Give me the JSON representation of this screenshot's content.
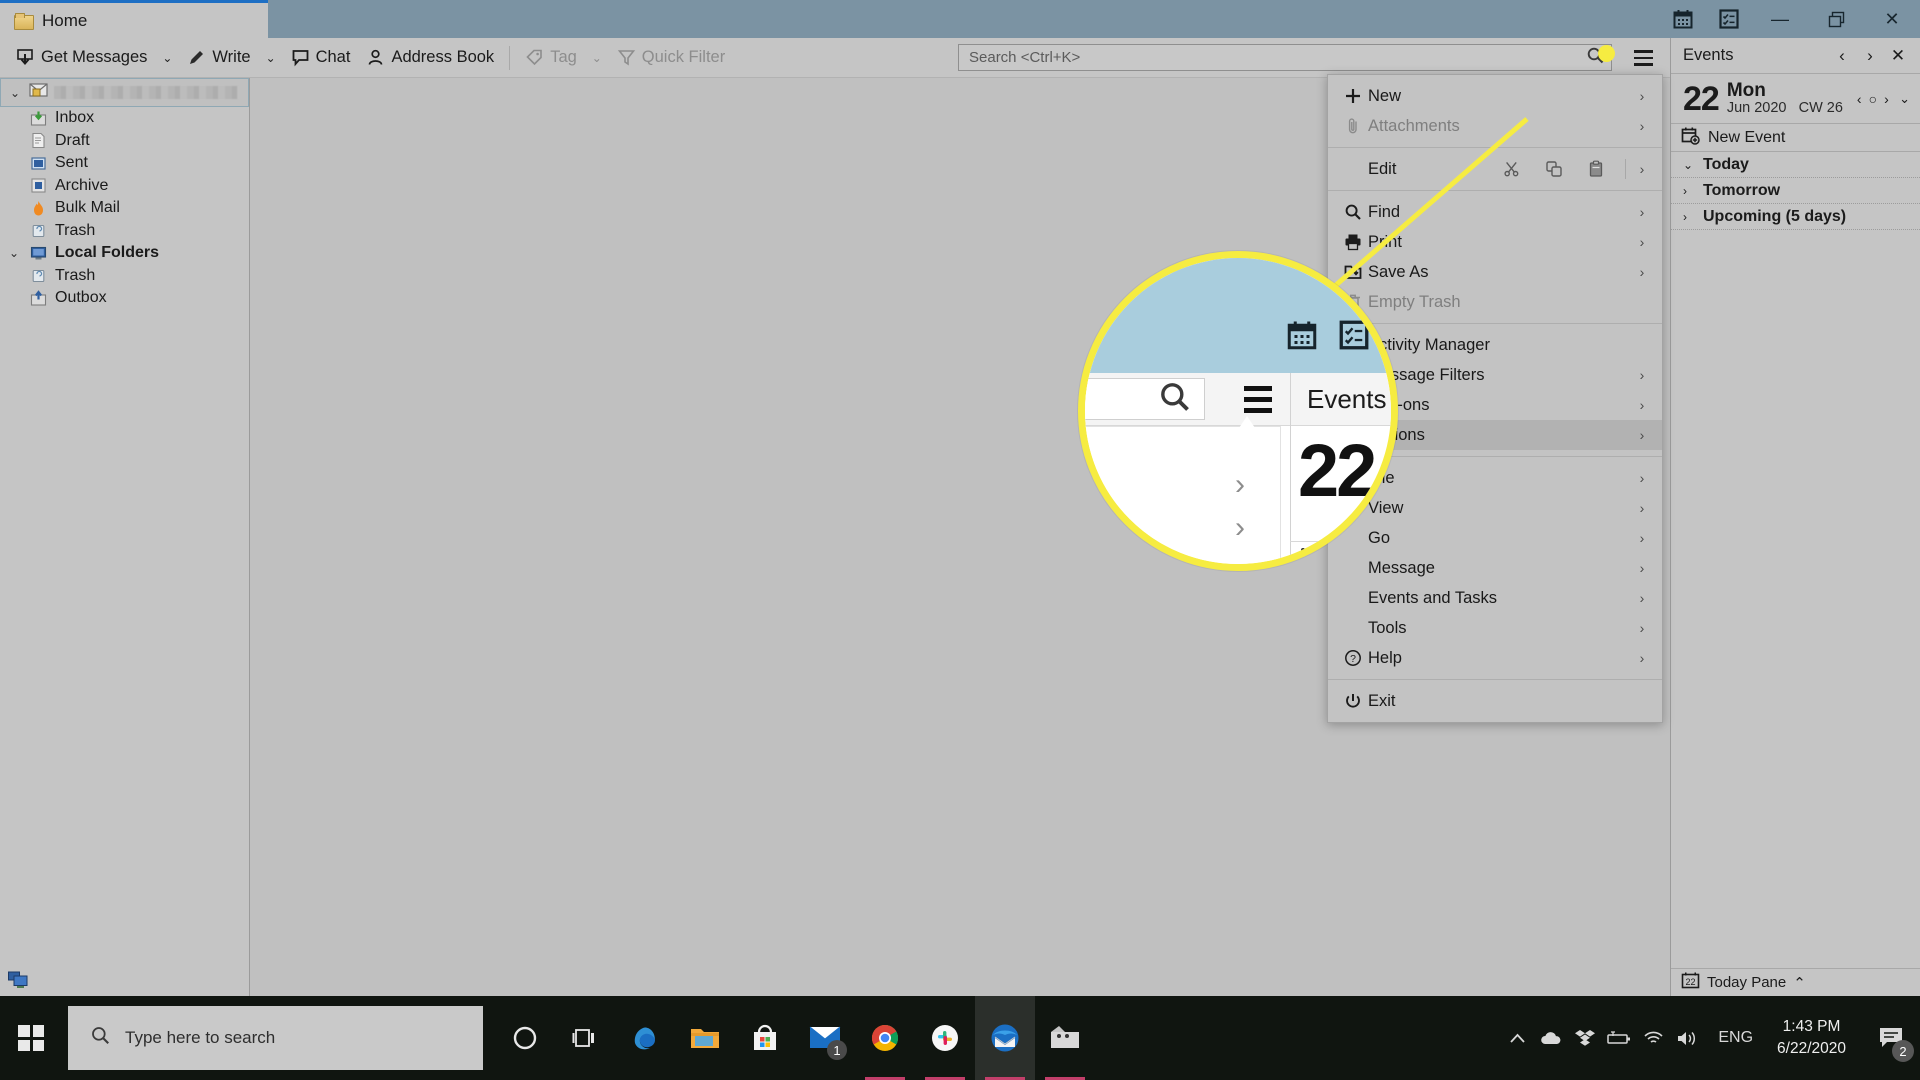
{
  "window": {
    "tab_label": "Home",
    "title_icons": [
      {
        "name": "calendar-icon",
        "glyph": "cal"
      },
      {
        "name": "tasks-icon",
        "glyph": "tasks"
      }
    ],
    "controls": {
      "minimize": "—",
      "restore": "❐",
      "close": "✕"
    }
  },
  "toolbar": {
    "get_messages": "Get Messages",
    "write": "Write",
    "chat": "Chat",
    "address_book": "Address Book",
    "tag": "Tag",
    "quick_filter": "Quick Filter",
    "caret": "⌄"
  },
  "search": {
    "placeholder": "Search <Ctrl+K>",
    "value": "Search <Ctrl+K>",
    "icon": "search-icon"
  },
  "folder_pane": {
    "account_label": "",
    "items": [
      {
        "label": "Inbox",
        "icon": "inbox-icon",
        "bold": false
      },
      {
        "label": "Draft",
        "icon": "draft-icon",
        "bold": false
      },
      {
        "label": "Sent",
        "icon": "sent-icon",
        "bold": false
      },
      {
        "label": "Archive",
        "icon": "archive-icon",
        "bold": false
      },
      {
        "label": "Bulk Mail",
        "icon": "bulk-mail-icon",
        "bold": false
      },
      {
        "label": "Trash",
        "icon": "trash-icon",
        "bold": false
      }
    ],
    "local_folders": {
      "label": "Local Folders",
      "items": [
        {
          "label": "Trash",
          "icon": "trash-icon",
          "bold": false
        },
        {
          "label": "Outbox",
          "icon": "outbox-icon",
          "bold": false
        }
      ]
    }
  },
  "app_menu": {
    "groups": [
      [
        {
          "label": "New",
          "icon": "plus-icon",
          "arrow": true,
          "disabled": false,
          "selected": false
        },
        {
          "label": "Attachments",
          "icon": "paperclip-icon",
          "arrow": true,
          "disabled": true,
          "selected": false
        }
      ],
      [
        {
          "label": "Edit",
          "icon": "",
          "arrow": true,
          "disabled": false,
          "selected": false,
          "edit_actions": [
            {
              "name": "cut-icon",
              "glyph": "✂"
            },
            {
              "name": "copy-icon",
              "glyph": "copy"
            },
            {
              "name": "paste-icon",
              "glyph": "paste"
            }
          ]
        }
      ],
      [
        {
          "label": "Find",
          "icon": "search-icon",
          "arrow": true,
          "disabled": false,
          "selected": false
        },
        {
          "label": "Print",
          "icon": "printer-icon",
          "arrow": true,
          "disabled": false,
          "selected": false
        },
        {
          "label": "Save As",
          "icon": "save-icon",
          "arrow": true,
          "disabled": false,
          "selected": false
        },
        {
          "label": "Empty Trash",
          "icon": "empty-trash-icon",
          "arrow": false,
          "disabled": true,
          "selected": false
        }
      ],
      [
        {
          "label": "Activity Manager",
          "icon": "",
          "arrow": false,
          "disabled": false,
          "selected": false
        },
        {
          "label": "Message Filters",
          "icon": "",
          "arrow": true,
          "disabled": false,
          "selected": false
        },
        {
          "label": "Add-ons",
          "icon": "",
          "arrow": true,
          "disabled": false,
          "selected": false
        },
        {
          "label": "Options",
          "icon": "",
          "arrow": true,
          "disabled": false,
          "selected": true
        }
      ],
      [
        {
          "label": "File",
          "icon": "",
          "arrow": true,
          "disabled": false,
          "selected": false
        },
        {
          "label": "View",
          "icon": "",
          "arrow": true,
          "disabled": false,
          "selected": false
        },
        {
          "label": "Go",
          "icon": "",
          "arrow": true,
          "disabled": false,
          "selected": false
        },
        {
          "label": "Message",
          "icon": "",
          "arrow": true,
          "disabled": false,
          "selected": false
        },
        {
          "label": "Events and Tasks",
          "icon": "",
          "arrow": true,
          "disabled": false,
          "selected": false
        },
        {
          "label": "Tools",
          "icon": "",
          "arrow": true,
          "disabled": false,
          "selected": false
        },
        {
          "label": "Help",
          "icon": "help-icon",
          "arrow": true,
          "disabled": false,
          "selected": false
        }
      ],
      [
        {
          "label": "Exit",
          "icon": "power-icon",
          "arrow": false,
          "disabled": false,
          "selected": false
        }
      ]
    ]
  },
  "today_pane": {
    "title": "Events",
    "nav_prev": "‹",
    "nav_next": "›",
    "close": "✕",
    "day_number": "22",
    "day_of_week": "Mon",
    "month_year": "Jun 2020",
    "week": "CW 26",
    "date_prev": "‹",
    "date_today": "○",
    "date_next": "›",
    "expand": "⌄",
    "new_event": "New Event",
    "sections": [
      {
        "label": "Today",
        "expanded": true
      },
      {
        "label": "Tomorrow",
        "expanded": false
      },
      {
        "label": "Upcoming (5 days)",
        "expanded": false
      }
    ],
    "footer": {
      "label": "Today Pane",
      "badge": "22",
      "chevron": "⌃"
    }
  },
  "magnifier": {
    "events_label": "Events",
    "day_number": "22",
    "arrow": "›",
    "accent_color": "#f6ec41"
  },
  "taskbar": {
    "search_placeholder": "Type here to search",
    "apps": [
      {
        "name": "cortana-icon",
        "active": false,
        "underline": false
      },
      {
        "name": "task-view-icon",
        "active": false,
        "underline": false
      },
      {
        "name": "edge-icon",
        "active": false,
        "underline": false
      },
      {
        "name": "file-explorer-icon",
        "active": false,
        "underline": false
      },
      {
        "name": "microsoft-store-icon",
        "active": false,
        "underline": false
      },
      {
        "name": "mail-icon",
        "active": false,
        "underline": false,
        "badge": "1"
      },
      {
        "name": "chrome-icon",
        "active": false,
        "underline": true
      },
      {
        "name": "slack-icon",
        "active": false,
        "underline": true
      },
      {
        "name": "thunderbird-icon",
        "active": true,
        "underline": true
      },
      {
        "name": "snagit-icon",
        "active": false,
        "underline": true
      }
    ],
    "tray": {
      "show_hidden": "⌃",
      "language": "ENG",
      "time": "1:43 PM",
      "date": "6/22/2020",
      "notification_count": "2"
    }
  }
}
